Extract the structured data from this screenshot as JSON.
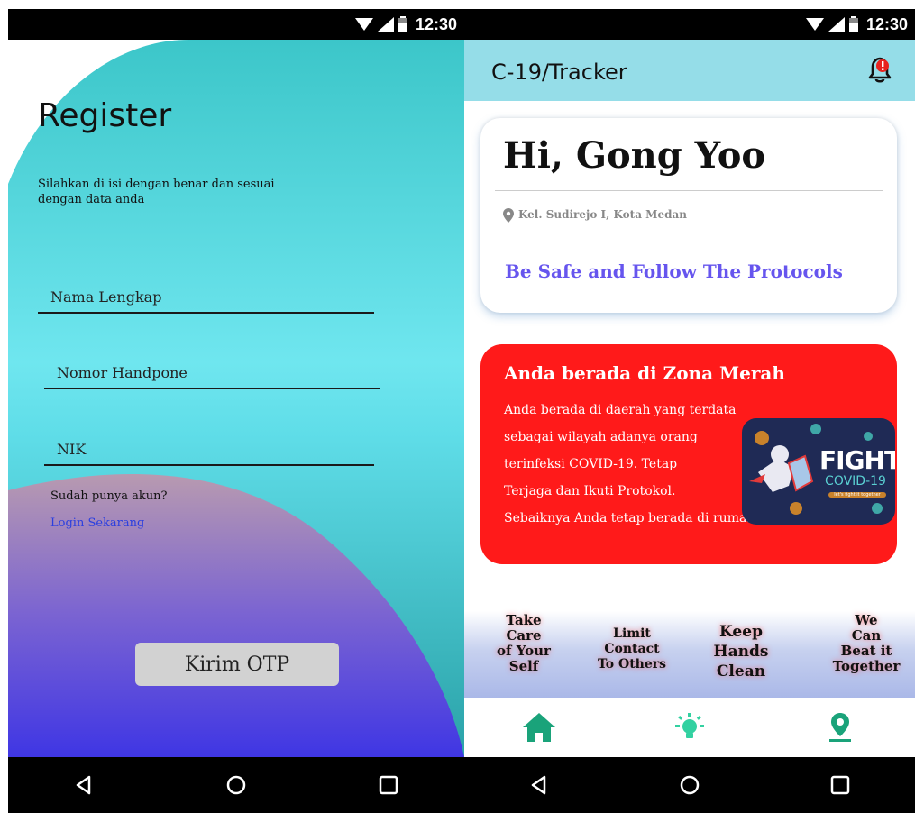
{
  "status_bar": {
    "time": "12:30"
  },
  "register": {
    "title": "Register",
    "subtitle": "Silahkan di isi dengan benar dan sesuai dengan data anda",
    "fields": {
      "name_placeholder": "Nama Lengkap",
      "phone_placeholder": "Nomor Handpone",
      "nik_placeholder": "NIK"
    },
    "have_account_label": "Sudah punya akun?",
    "login_link": "Login Sekarang",
    "submit_button": "Kirim OTP"
  },
  "tracker": {
    "app_title": "C-19/Tracker",
    "greeting": "Hi, Gong Yoo",
    "location": "Kel. Sudirejo I, Kota Medan",
    "message": "Be Safe and Follow The Protocols",
    "zone": {
      "title": "Anda berada di Zona Merah",
      "lines": [
        "Anda berada di daerah yang terdata",
        "sebagai wilayah adanya orang",
        "terinfeksi COVID-19. Tetap",
        "Terjaga dan Ikuti Protokol.",
        "Sebaiknya Anda tetap berada di rumah."
      ],
      "image_text": {
        "line1": "FIGHT",
        "line2": "COVID-19",
        "line3": "let's fight it together"
      }
    },
    "tips": [
      {
        "l1": "Take",
        "l2": "Care",
        "l3": "of Your",
        "l4": "Self"
      },
      {
        "l1": "Limit",
        "l2": "Contact",
        "l3": "To Others"
      },
      {
        "l1": "Keep",
        "l2": "Hands",
        "l3": "Clean"
      },
      {
        "l1": "We",
        "l2": "Can",
        "l3": "Beat it",
        "l4": "Together"
      }
    ],
    "bottom_nav": [
      "home-icon",
      "lightbulb-icon",
      "location-pin-icon"
    ]
  },
  "colors": {
    "accent_teal": "#1aa37a",
    "zone_red": "#ff1a1a",
    "message_purple": "#6655ee",
    "appbar": "#95dde8"
  }
}
